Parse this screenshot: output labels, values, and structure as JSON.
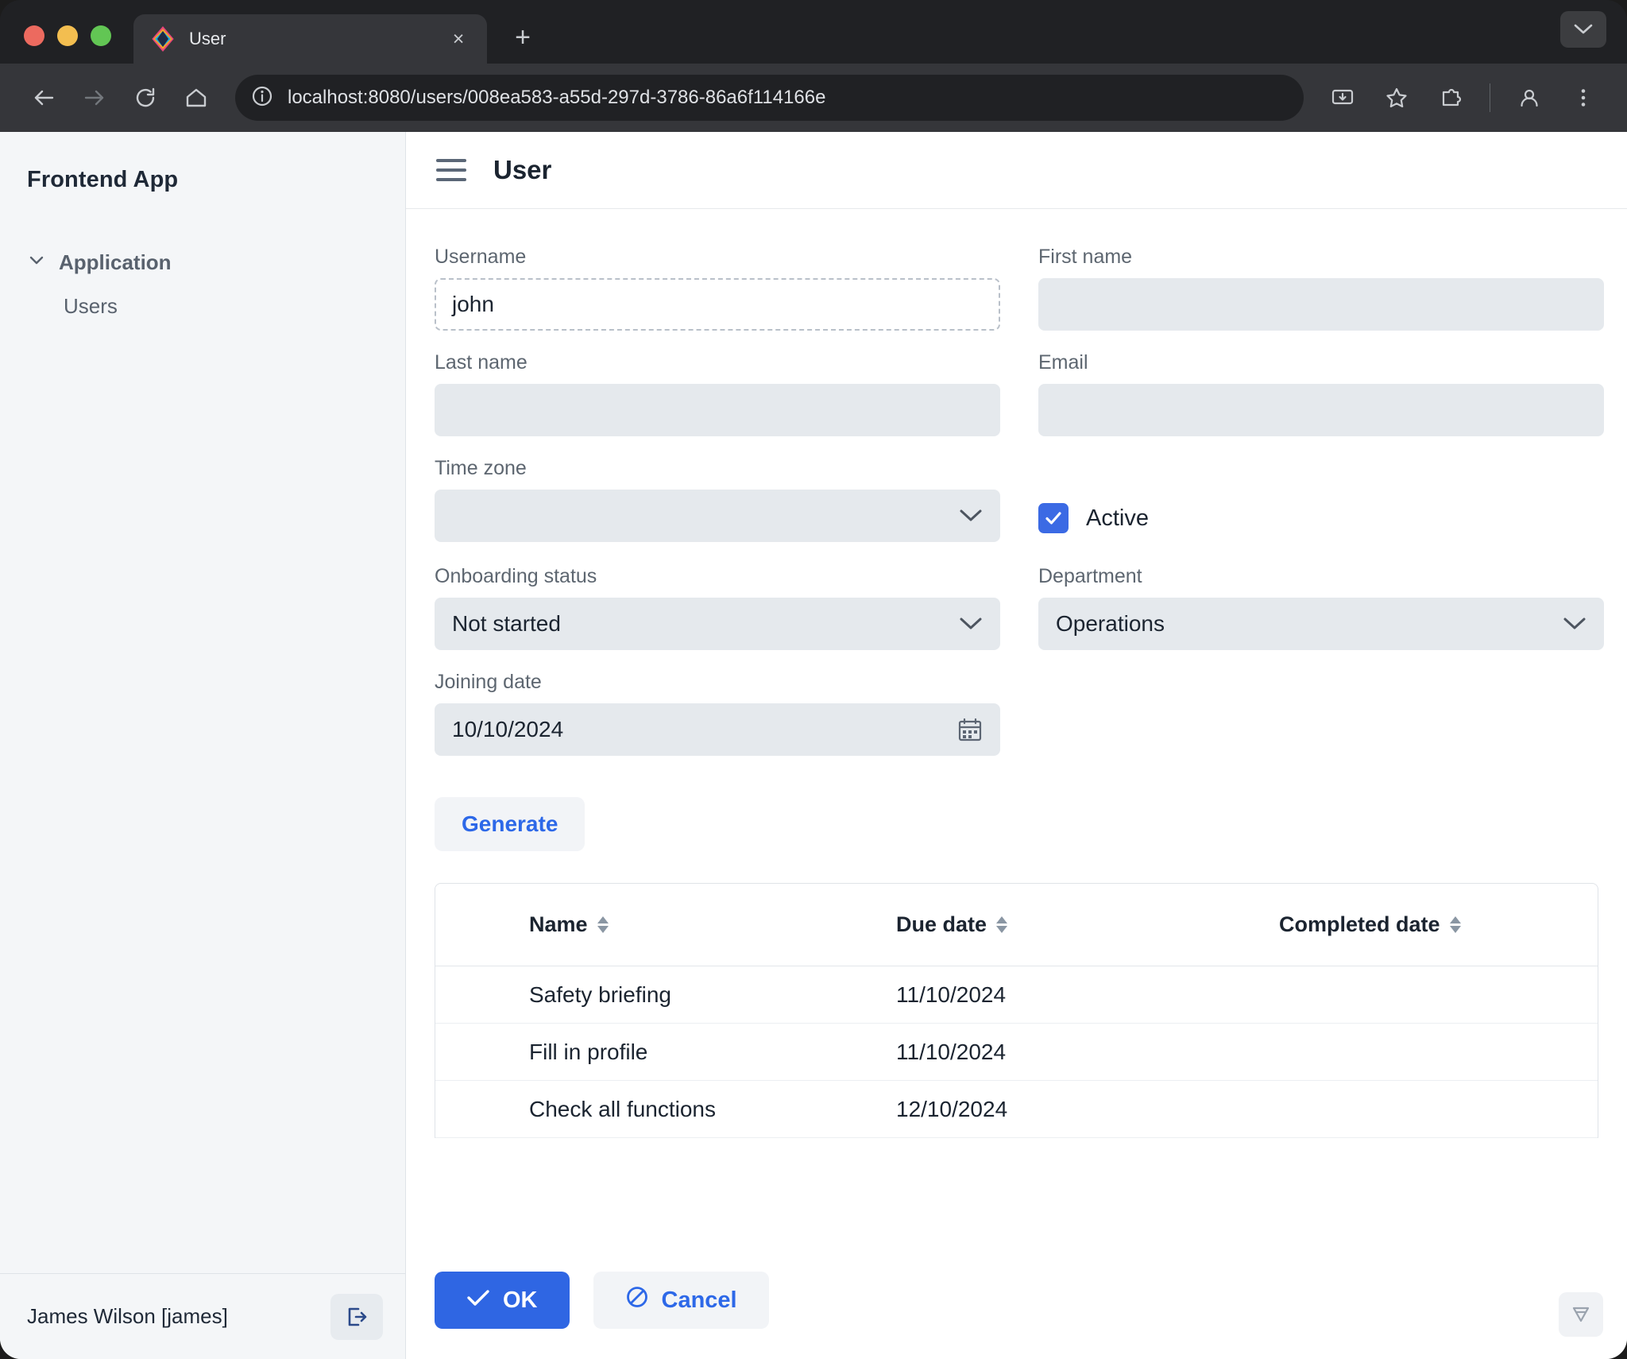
{
  "browser": {
    "tab": {
      "title": "User",
      "favicon": "diamond-logo-icon",
      "close": "×"
    },
    "new_tab_label": "+",
    "url": "localhost:8080/users/008ea583-a55d-297d-3786-86a6f114166e",
    "nav": {
      "back": "back-icon",
      "forward": "forward-icon",
      "reload": "reload-icon",
      "home": "home-icon"
    },
    "right_icons": [
      "install-icon",
      "bookmark-star-icon",
      "extensions-icon",
      "profile-icon",
      "more-menu-icon"
    ]
  },
  "sidebar": {
    "brand": "Frontend App",
    "groups": [
      {
        "label": "Application",
        "expanded": true,
        "items": [
          {
            "label": "Users"
          }
        ]
      }
    ],
    "footer": {
      "user": "James Wilson [james]",
      "logout_icon": "logout-icon"
    }
  },
  "header": {
    "menu_icon": "hamburger-icon",
    "title": "User"
  },
  "form": {
    "username": {
      "label": "Username",
      "value": "john"
    },
    "first_name": {
      "label": "First name",
      "value": ""
    },
    "last_name": {
      "label": "Last name",
      "value": ""
    },
    "email": {
      "label": "Email",
      "value": ""
    },
    "time_zone": {
      "label": "Time zone",
      "value": ""
    },
    "active": {
      "label": "Active",
      "checked": true
    },
    "onboarding_status": {
      "label": "Onboarding status",
      "value": "Not started"
    },
    "department": {
      "label": "Department",
      "value": "Operations"
    },
    "joining_date": {
      "label": "Joining date",
      "value": "10/10/2024"
    },
    "generate_button": "Generate"
  },
  "table": {
    "columns": [
      "Name",
      "Due date",
      "Completed date"
    ],
    "rows": [
      {
        "name": "Safety briefing",
        "due_date": "11/10/2024",
        "completed_date": ""
      },
      {
        "name": "Fill in profile",
        "due_date": "11/10/2024",
        "completed_date": ""
      },
      {
        "name": "Check all functions",
        "due_date": "12/10/2024",
        "completed_date": ""
      }
    ]
  },
  "footer": {
    "ok": "OK",
    "cancel": "Cancel"
  },
  "colors": {
    "accent_blue": "#2f66e3",
    "checkbox_blue": "#3b6ae4",
    "input_bg": "#e5e9ed",
    "sidebar_bg": "#f4f6f8",
    "text_dark": "#1b2430",
    "label_gray": "#5d6670"
  }
}
